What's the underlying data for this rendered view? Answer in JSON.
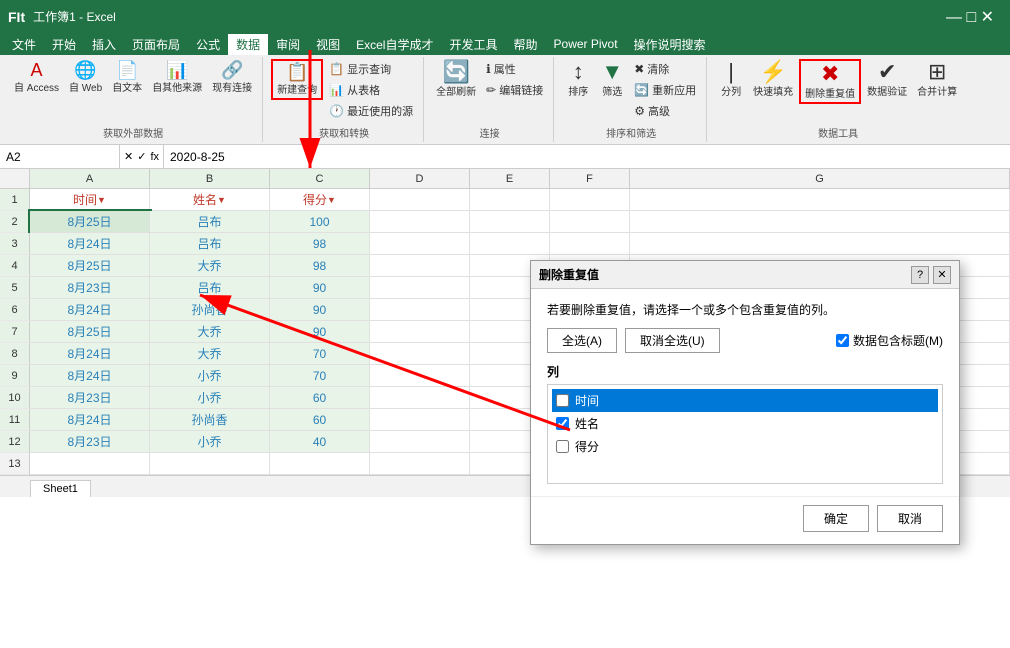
{
  "app": {
    "title": "FIt",
    "filename": "工作簿1 - Excel"
  },
  "menu": {
    "items": [
      "文件",
      "开始",
      "插入",
      "页面布局",
      "公式",
      "数据",
      "审阅",
      "视图",
      "Excel自学成才",
      "开发工具",
      "帮助",
      "Power Pivot",
      "操作说明搜索"
    ],
    "active": "数据"
  },
  "ribbon": {
    "groups": [
      {
        "label": "获取外部数据",
        "items": [
          {
            "icon": "A",
            "label": "自 Access"
          },
          {
            "icon": "W",
            "label": "自 Web"
          },
          {
            "icon": "T",
            "label": "自文本"
          },
          {
            "icon": "S",
            "label": "自其他来源"
          },
          {
            "icon": "C",
            "label": "现有连接"
          }
        ]
      },
      {
        "label": "获取和转换",
        "items": [
          {
            "icon": "N",
            "label": "新建查询"
          },
          {
            "icon": "D",
            "label": "显示查询"
          },
          {
            "icon": "T",
            "label": "从表格"
          },
          {
            "icon": "R",
            "label": "最近使用的源"
          }
        ]
      },
      {
        "label": "连接",
        "items": [
          {
            "icon": "R",
            "label": "全部刷新"
          },
          {
            "icon": "P",
            "label": "属性"
          },
          {
            "icon": "L",
            "label": "编辑链接"
          }
        ]
      },
      {
        "label": "排序和筛选",
        "items": [
          {
            "icon": "↑↓",
            "label": "排序"
          },
          {
            "icon": "▼",
            "label": "筛选"
          },
          {
            "icon": "C",
            "label": "清除"
          },
          {
            "icon": "R",
            "label": "重新应用"
          },
          {
            "icon": "A",
            "label": "高级"
          }
        ]
      },
      {
        "label": "数据工具",
        "items": [
          {
            "icon": "|",
            "label": "分列"
          },
          {
            "icon": "F",
            "label": "快速填充"
          },
          {
            "icon": "X",
            "label": "删除重复值"
          },
          {
            "icon": "V",
            "label": "数据验证"
          },
          {
            "icon": "M",
            "label": "合并计算"
          }
        ]
      }
    ]
  },
  "formulaBar": {
    "nameBox": "A2",
    "formula": "2020-8-25"
  },
  "columns": {
    "headers": [
      "",
      "A",
      "B",
      "C",
      "D",
      "E",
      "F",
      "G"
    ],
    "widths": [
      30,
      120,
      120,
      100,
      100,
      80,
      80,
      80
    ]
  },
  "rows": [
    {
      "num": 1,
      "cells": [
        "时间",
        "姓名",
        "得分",
        "",
        "",
        "",
        ""
      ]
    },
    {
      "num": 2,
      "cells": [
        "8月25日",
        "吕布",
        "100",
        "",
        "",
        "",
        ""
      ]
    },
    {
      "num": 3,
      "cells": [
        "8月24日",
        "吕布",
        "98",
        "",
        "",
        "",
        ""
      ]
    },
    {
      "num": 4,
      "cells": [
        "8月25日",
        "大乔",
        "98",
        "",
        "",
        "",
        ""
      ]
    },
    {
      "num": 5,
      "cells": [
        "8月23日",
        "吕布",
        "90",
        "",
        "",
        "",
        ""
      ]
    },
    {
      "num": 6,
      "cells": [
        "8月24日",
        "孙尚香",
        "90",
        "",
        "",
        "",
        ""
      ]
    },
    {
      "num": 7,
      "cells": [
        "8月25日",
        "大乔",
        "90",
        "",
        "",
        "",
        ""
      ]
    },
    {
      "num": 8,
      "cells": [
        "8月24日",
        "大乔",
        "70",
        "",
        "",
        "",
        ""
      ]
    },
    {
      "num": 9,
      "cells": [
        "8月24日",
        "小乔",
        "70",
        "",
        "",
        "",
        ""
      ]
    },
    {
      "num": 10,
      "cells": [
        "8月23日",
        "小乔",
        "60",
        "",
        "",
        "",
        ""
      ]
    },
    {
      "num": 11,
      "cells": [
        "8月24日",
        "孙尚香",
        "60",
        "",
        "",
        "",
        ""
      ]
    },
    {
      "num": 12,
      "cells": [
        "8月23日",
        "小乔",
        "40",
        "",
        "",
        "",
        ""
      ]
    },
    {
      "num": 13,
      "cells": [
        "",
        "",
        "",
        "",
        "",
        "",
        ""
      ]
    }
  ],
  "dialog": {
    "title": "删除重复值",
    "description": "若要删除重复值，请选择一个或多个包含重复值的列。",
    "btn_select_all": "全选(A)",
    "btn_deselect_all": "取消全选(U)",
    "checkbox_header": "数据包含标题(M)",
    "columns_label": "列",
    "columns": [
      {
        "label": "时间",
        "checked": false,
        "selected": true
      },
      {
        "label": "姓名",
        "checked": true,
        "selected": false
      },
      {
        "label": "得分",
        "checked": false,
        "selected": false
      }
    ],
    "btn_ok": "确定",
    "btn_cancel": "取消"
  },
  "sheetTab": {
    "name": "Sheet1"
  }
}
